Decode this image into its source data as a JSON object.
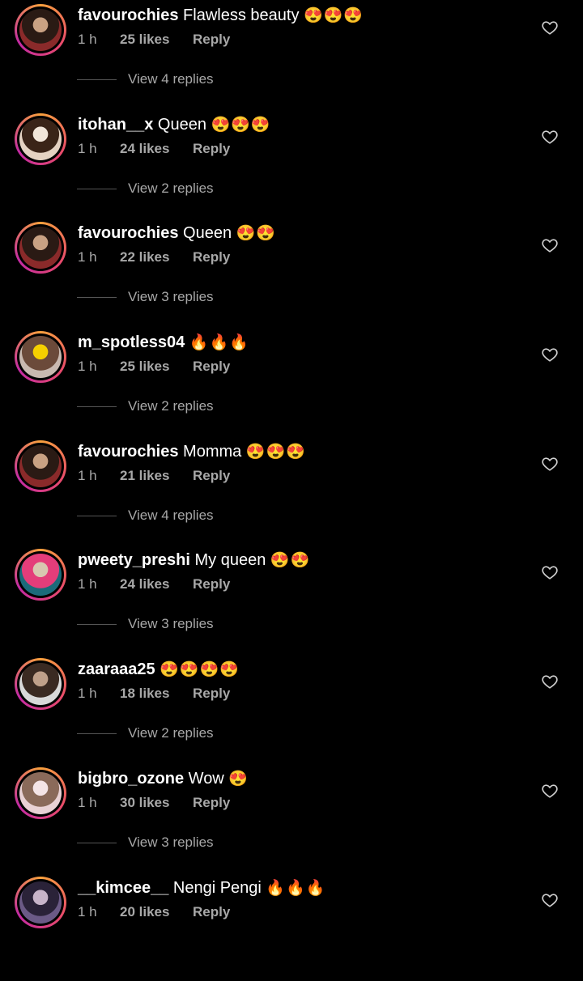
{
  "colors": {
    "background": "#000000",
    "secondary_text": "#a8a8a8",
    "ring_start": "#f9a13d",
    "ring_end": "#c32aa3"
  },
  "comments": [
    {
      "username": "favourochies",
      "text": "Flawless beauty",
      "emojis": "😍😍😍",
      "time": "1 h",
      "likes": "25 likes",
      "reply_label": "Reply",
      "view_replies": "View 4 replies",
      "avatar_icon": "profile-photo",
      "avatar_colors": [
        "#8a2a2a",
        "#2a1a14",
        "#c9a183"
      ]
    },
    {
      "username": "itohan__x",
      "text": "Queen",
      "emojis": "😍😍😍",
      "time": "1 h",
      "likes": "24 likes",
      "reply_label": "Reply",
      "view_replies": "View 2 replies",
      "avatar_icon": "profile-photo",
      "avatar_colors": [
        "#e4d2c2",
        "#3a2418",
        "#f1e6d9"
      ]
    },
    {
      "username": "favourochies",
      "text": "Queen",
      "emojis": "😍😍",
      "time": "1 h",
      "likes": "22 likes",
      "reply_label": "Reply",
      "view_replies": "View 3 replies",
      "avatar_icon": "profile-photo",
      "avatar_colors": [
        "#8a2a2a",
        "#2a1a14",
        "#c9a183"
      ]
    },
    {
      "username": "m_spotless04",
      "text": "",
      "emojis": "🔥🔥🔥",
      "time": "1 h",
      "likes": "25 likes",
      "reply_label": "Reply",
      "view_replies": "View 2 replies",
      "avatar_icon": "profile-photo",
      "avatar_colors": [
        "#c9b9b0",
        "#6b4a3a",
        "#f5d000"
      ]
    },
    {
      "username": "favourochies",
      "text": "Momma",
      "emojis": "😍😍😍",
      "time": "1 h",
      "likes": "21 likes",
      "reply_label": "Reply",
      "view_replies": "View 4 replies",
      "avatar_icon": "profile-photo",
      "avatar_colors": [
        "#8a2a2a",
        "#2a1a14",
        "#c9a183"
      ]
    },
    {
      "username": "pweety_preshi",
      "text": "My queen",
      "emojis": "😍😍",
      "time": "1 h",
      "likes": "24 likes",
      "reply_label": "Reply",
      "view_replies": "View 3 replies",
      "avatar_icon": "profile-photo",
      "avatar_colors": [
        "#1b6b7a",
        "#e43d7a",
        "#d8c7b0"
      ]
    },
    {
      "username": "zaaraaa25",
      "text": "",
      "emojis": "😍😍😍😍",
      "time": "1 h",
      "likes": "18 likes",
      "reply_label": "Reply",
      "view_replies": "View 2 replies",
      "avatar_icon": "profile-photo",
      "avatar_colors": [
        "#d9d9d9",
        "#3a2a22",
        "#bfa08a"
      ]
    },
    {
      "username": "bigbro_ozone",
      "text": "Wow",
      "emojis": "😍",
      "time": "1 h",
      "likes": "30 likes",
      "reply_label": "Reply",
      "view_replies": "View 3 replies",
      "avatar_icon": "profile-photo",
      "avatar_colors": [
        "#e9d2d5",
        "#8a6a5a",
        "#f4e4e6"
      ]
    },
    {
      "username": "__kimcee__",
      "text": "Nengi Pengi",
      "emojis": "🔥🔥🔥",
      "time": "1 h",
      "likes": "20 likes",
      "reply_label": "Reply",
      "view_replies": "",
      "avatar_icon": "profile-photo",
      "avatar_colors": [
        "#6b5a86",
        "#2a2238",
        "#c7b4c9"
      ]
    }
  ]
}
